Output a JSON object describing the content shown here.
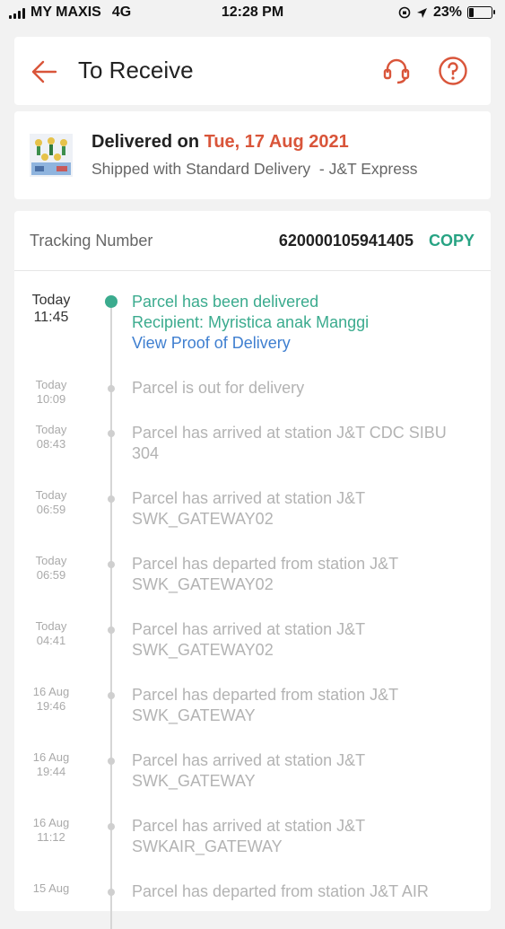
{
  "status_bar": {
    "carrier": "MY MAXIS",
    "network": "4G",
    "time": "12:28 PM",
    "battery": "23%",
    "icons": [
      "signal-icon",
      "screen-rotation-lock-icon",
      "location-arrow-icon",
      "battery-icon"
    ]
  },
  "header": {
    "title": "To Receive",
    "icons": {
      "back": "back-arrow-icon",
      "support": "headset-icon",
      "help": "question-icon"
    },
    "accent_color": "#d9553a"
  },
  "delivery": {
    "prefix": "Delivered on ",
    "date": "Tue, 17 Aug 2021",
    "subtitle": "Shipped with Standard Delivery  - J&T Express"
  },
  "tracking": {
    "label": "Tracking Number",
    "number": "620000105941405",
    "copy_label": "COPY",
    "copy_color": "#27a383"
  },
  "events": [
    {
      "day": "Today",
      "time": "11:45",
      "lines": [
        "Parcel has been delivered",
        "Recipient: Myristica anak Manggi"
      ],
      "link": "View Proof of Delivery"
    },
    {
      "day": "Today",
      "time": "10:09",
      "lines": [
        "Parcel is out for delivery"
      ]
    },
    {
      "day": "Today",
      "time": "08:43",
      "lines": [
        "Parcel has arrived at station J&T CDC SIBU",
        "304"
      ]
    },
    {
      "day": "Today",
      "time": "06:59",
      "lines": [
        "Parcel has arrived at station J&T",
        "SWK_GATEWAY02"
      ]
    },
    {
      "day": "Today",
      "time": "06:59",
      "lines": [
        "Parcel has departed from station J&T",
        "SWK_GATEWAY02"
      ]
    },
    {
      "day": "Today",
      "time": "04:41",
      "lines": [
        "Parcel has arrived at station J&T",
        "SWK_GATEWAY02"
      ]
    },
    {
      "day": "16 Aug",
      "time": "19:46",
      "lines": [
        "Parcel has departed from station J&T",
        "SWK_GATEWAY"
      ]
    },
    {
      "day": "16 Aug",
      "time": "19:44",
      "lines": [
        "Parcel has arrived at station J&T",
        "SWK_GATEWAY"
      ]
    },
    {
      "day": "16 Aug",
      "time": "11:12",
      "lines": [
        "Parcel has arrived at station J&T",
        "SWKAIR_GATEWAY"
      ]
    },
    {
      "day": "15 Aug",
      "time": "",
      "lines": [
        "Parcel has departed from station J&T AIR"
      ]
    }
  ]
}
